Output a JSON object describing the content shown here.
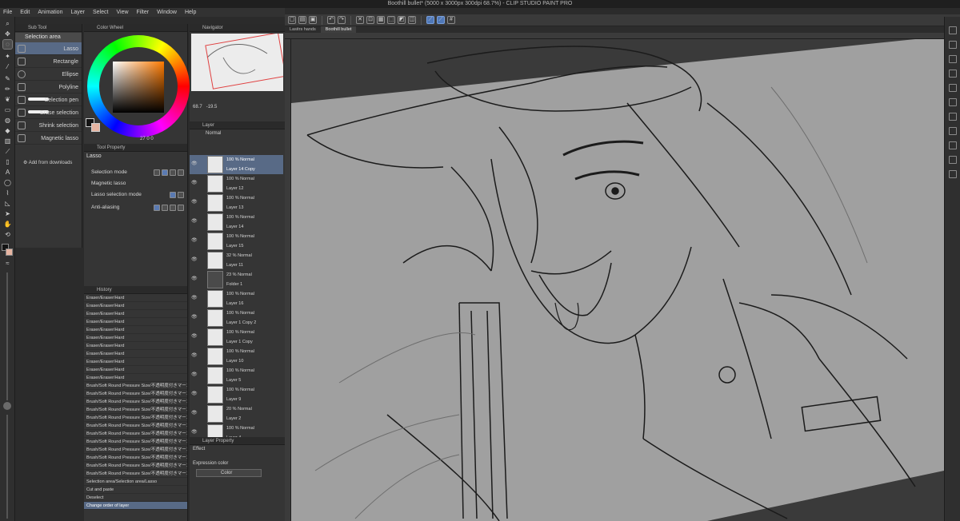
{
  "window": {
    "title": "Boothill bullet* (5000 x 3000px 300dpi 68.7%) - CLIP STUDIO PAINT PRO"
  },
  "menu": [
    "File",
    "Edit",
    "Animation",
    "Layer",
    "Select",
    "View",
    "Filter",
    "Window",
    "Help"
  ],
  "subtool": {
    "tab": "Sub Tool",
    "group": "Selection area",
    "items": [
      "Lasso",
      "Rectangle",
      "Ellipse",
      "Polyline",
      "Selection pen",
      "Erase selection",
      "Shrink selection",
      "Magnetic lasso"
    ],
    "add_label": "Add from downloads"
  },
  "color": {
    "tab": "Color Wheel",
    "readout": "27  0  0",
    "main_color": "#141414",
    "sub_color": "#e7b5a2"
  },
  "toolprop": {
    "tab": "Tool Property",
    "title": "Lasso",
    "rows": [
      "Selection mode",
      "Magnetic lasso",
      "Lasso selection mode",
      "Anti-aliasing"
    ]
  },
  "history": {
    "tab": "History",
    "items": [
      "Eraser/Eraser/Hard",
      "Eraser/Eraser/Hard",
      "Eraser/Eraser/Hard",
      "Eraser/Eraser/Hard",
      "Eraser/Eraser/Hard",
      "Eraser/Eraser/Hard",
      "Eraser/Eraser/Hard",
      "Eraser/Eraser/Hard",
      "Eraser/Eraser/Hard",
      "Eraser/Eraser/Hard",
      "Eraser/Eraser/Hard",
      "Brush/Soft Round Pressure Size/不透明度付きマーカーペン4",
      "Brush/Soft Round Pressure Size/不透明度付きマーカーペン4",
      "Brush/Soft Round Pressure Size/不透明度付きマーカーペン4",
      "Brush/Soft Round Pressure Size/不透明度付きマーカーペン4",
      "Brush/Soft Round Pressure Size/不透明度付きマーカーペン4",
      "Brush/Soft Round Pressure Size/不透明度付きマーカーペン4",
      "Brush/Soft Round Pressure Size/不透明度付きマーカーペン4",
      "Brush/Soft Round Pressure Size/不透明度付きマーカーペン4",
      "Brush/Soft Round Pressure Size/不透明度付きマーカーペン4",
      "Brush/Soft Round Pressure Size/不透明度付きマーカーペン4",
      "Brush/Soft Round Pressure Size/不透明度付きマーカーペン4",
      "Brush/Soft Round Pressure Size/不透明度付きマーカーペン4",
      "Selection area/Selection area/Lasso",
      "Cut and paste",
      "Deselect",
      "Change order of layer"
    ]
  },
  "navigator": {
    "tab": "Navigator",
    "zoom": "68.7",
    "angle": "-19.5"
  },
  "layers": {
    "tab": "Layer",
    "blend": "Normal",
    "items": [
      {
        "pct": "100 % Normal",
        "name": "Layer 14 Copy",
        "sel": true
      },
      {
        "pct": "100 % Normal",
        "name": "Layer 12"
      },
      {
        "pct": "100 % Normal",
        "name": "Layer 13"
      },
      {
        "pct": "100 % Normal",
        "name": "Layer 14"
      },
      {
        "pct": "100 % Normal",
        "name": "Layer 15"
      },
      {
        "pct": "32 % Normal",
        "name": "Layer 11"
      },
      {
        "pct": "23 % Normal",
        "name": "Folder 1",
        "folder": true
      },
      {
        "pct": "100 % Normal",
        "name": "Layer 16"
      },
      {
        "pct": "100 % Normal",
        "name": "Layer 1 Copy 2"
      },
      {
        "pct": "100 % Normal",
        "name": "Layer 1 Copy"
      },
      {
        "pct": "100 % Normal",
        "name": "Layer 10"
      },
      {
        "pct": "100 % Normal",
        "name": "Layer 5"
      },
      {
        "pct": "100 % Normal",
        "name": "Layer 9"
      },
      {
        "pct": "20 % Normal",
        "name": "Layer 2"
      },
      {
        "pct": "100 % Normal",
        "name": "Layer 4"
      }
    ]
  },
  "layerprop": {
    "tab": "Layer Property",
    "effect": "Effect",
    "expr_label": "Expression color",
    "expr_value": "Color"
  },
  "canvas": {
    "tabs": [
      "Lasitrs hands",
      "Boothill bullet"
    ],
    "paper_color": "#a0a0a0"
  }
}
